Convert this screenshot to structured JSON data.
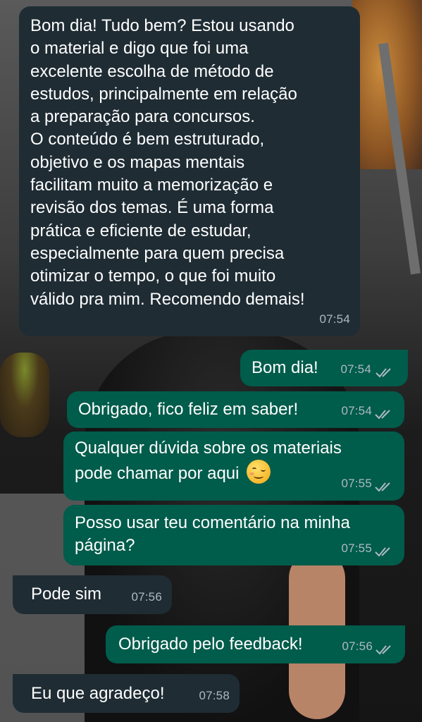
{
  "messages": [
    {
      "id": "m1",
      "dir": "in",
      "text": "Bom dia! Tudo bem? Estou usando\no material e digo que foi uma\nexcelente escolha de método de\nestudos, principalmente em relação\na preparação para concursos.\nO conteúdo é bem estruturado,\nobjetivo e os mapas mentais\nfacilitam muito a memorização e\nrevisão dos temas. É uma forma\nprática e eficiente de estudar,\nespecialmente para quem precisa\notimizar o tempo, o que foi muito\nválido pra mim. Recomendo demais!",
      "time": "07:54"
    },
    {
      "id": "m2",
      "dir": "out",
      "text": "Bom dia!",
      "time": "07:54",
      "status": "read"
    },
    {
      "id": "m3",
      "dir": "out",
      "text": "Obrigado, fico feliz em saber!",
      "time": "07:54",
      "status": "read"
    },
    {
      "id": "m4",
      "dir": "out",
      "text": "Qualquer dúvida sobre os materiais\npode chamar por aqui",
      "emoji": "smirking-face-emoji",
      "time": "07:55",
      "status": "read"
    },
    {
      "id": "m5",
      "dir": "out",
      "text": "Posso usar teu comentário na minha\npágina?",
      "time": "07:55",
      "status": "read"
    },
    {
      "id": "m6",
      "dir": "in",
      "text": "Pode sim",
      "time": "07:56"
    },
    {
      "id": "m7",
      "dir": "out",
      "text": "Obrigado pelo feedback!",
      "time": "07:56",
      "status": "read"
    },
    {
      "id": "m8",
      "dir": "in",
      "text": "Eu que agradeço!",
      "time": "07:58"
    }
  ],
  "colors": {
    "incoming_bubble": "#1f2c34",
    "outgoing_bubble": "#005c4b",
    "timestamp": "#aebac1",
    "read_ticks": "#aebac1"
  },
  "icons": {
    "read_status": "double-check-icon"
  }
}
